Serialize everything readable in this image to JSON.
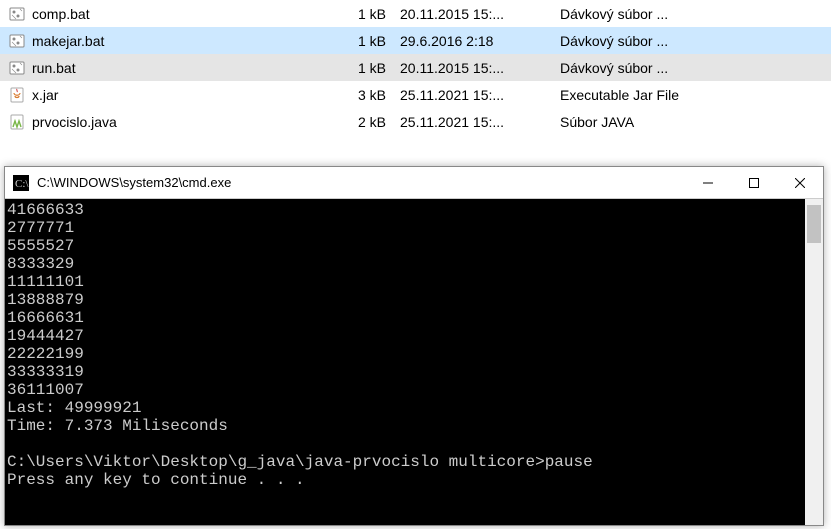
{
  "files": [
    {
      "name": "comp.bat",
      "size": "1 kB",
      "date": "20.11.2015 15:...",
      "type": "Dávkový súbor ...",
      "icon": "bat",
      "state": ""
    },
    {
      "name": "makejar.bat",
      "size": "1 kB",
      "date": "29.6.2016 2:18",
      "type": "Dávkový súbor ...",
      "icon": "bat",
      "state": "sel"
    },
    {
      "name": "run.bat",
      "size": "1 kB",
      "date": "20.11.2015 15:...",
      "type": "Dávkový súbor ...",
      "icon": "bat",
      "state": "hl"
    },
    {
      "name": "x.jar",
      "size": "3 kB",
      "date": "25.11.2021 15:...",
      "type": "Executable Jar File",
      "icon": "jar",
      "state": ""
    },
    {
      "name": "prvocislo.java",
      "size": "2 kB",
      "date": "25.11.2021 15:...",
      "type": "Súbor JAVA",
      "icon": "java",
      "state": ""
    }
  ],
  "cmd": {
    "title": "C:\\WINDOWS\\system32\\cmd.exe",
    "output": "41666633\n2777771\n5555527\n8333329\n11111101\n13888879\n16666631\n19444427\n22222199\n33333319\n36111007\nLast: 49999921\nTime: 7.373 Miliseconds\n\nC:\\Users\\Viktor\\Desktop\\g_java\\java-prvocislo multicore>pause\nPress any key to continue . . ."
  }
}
